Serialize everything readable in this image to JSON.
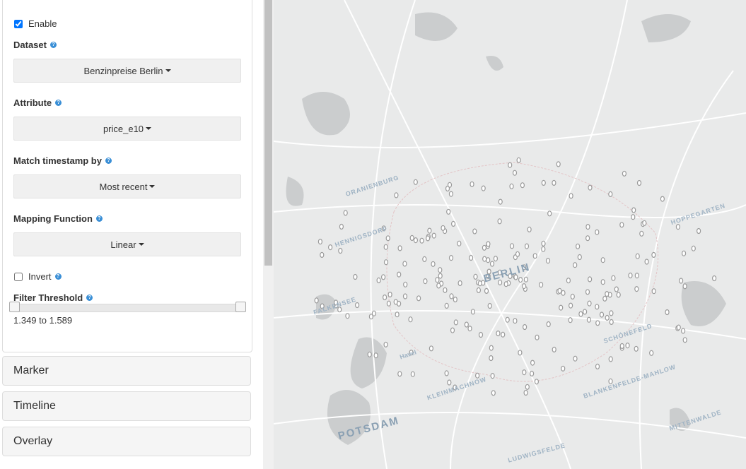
{
  "sidebar": {
    "enable": {
      "label": "Enable",
      "checked": true
    },
    "dataset": {
      "label": "Dataset",
      "value": "Benzinpreise Berlin"
    },
    "attribute": {
      "label": "Attribute",
      "value": "price_e10"
    },
    "match_timestamp": {
      "label": "Match timestamp by",
      "value": "Most recent"
    },
    "mapping_function": {
      "label": "Mapping Function",
      "value": "Linear"
    },
    "invert": {
      "label": "Invert",
      "checked": false
    },
    "filter_threshold": {
      "label": "Filter Threshold",
      "range_text": "1.349 to 1.589",
      "low_fraction": 0.0,
      "high_fraction": 1.0
    },
    "help_icon": "?",
    "sections": [
      {
        "label": "Marker"
      },
      {
        "label": "Timeline"
      },
      {
        "label": "Overlay"
      }
    ]
  },
  "map": {
    "labels": {
      "berlin": "BERLIN",
      "potsdam": "POTSDAM",
      "kleinmachnow": "KLEINMACHNOW",
      "blankenfelde": "BLANKENFELDE-MAHLOW",
      "schonefeld": "SCHÖNEFELD",
      "hoppegarten": "HOPPEGARTEN",
      "falkensee": "FALKENSEE",
      "hennigsdorf": "HENNIGSDORF",
      "mittenwalde": "MITTENWALDE",
      "oranienburg": "ORANIENBURG",
      "havel": "Havel",
      "ludwigsfelde": "LUDWIGSFELDE"
    },
    "colors": {
      "water": "#c9cbcc",
      "roads": "#ffffff",
      "land": "#e9eaea",
      "marker": "#9a9a9a"
    }
  }
}
